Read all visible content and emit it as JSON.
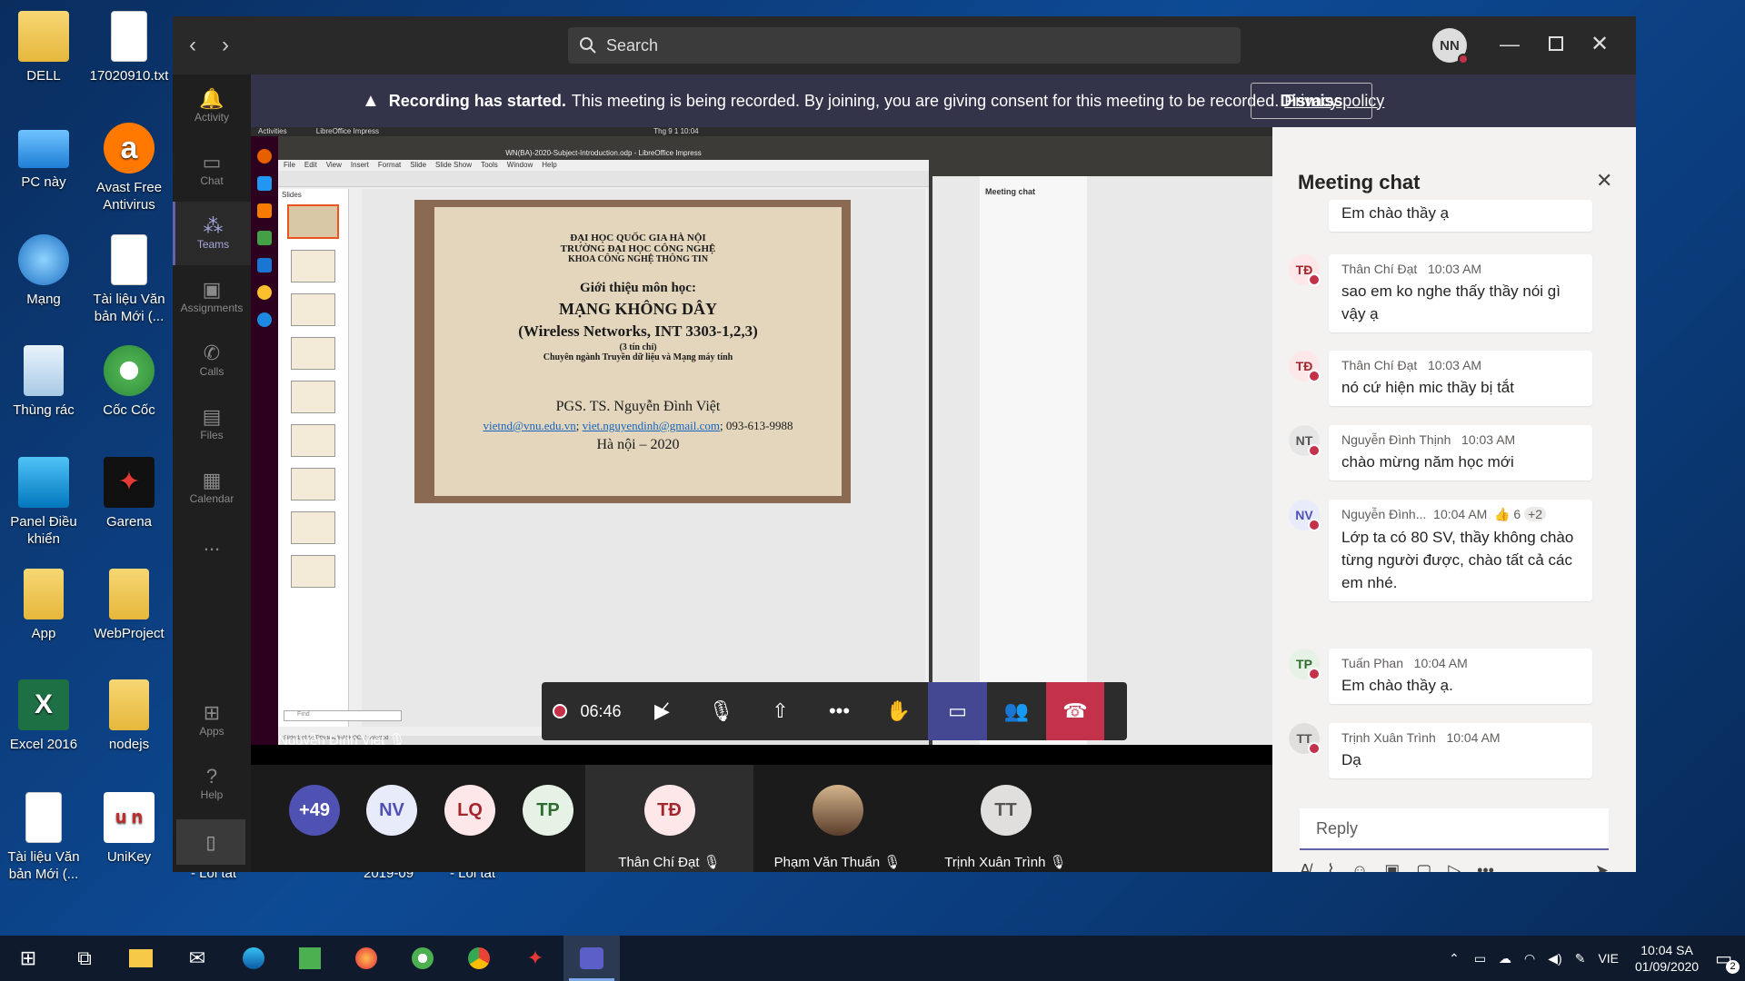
{
  "desktop": {
    "icons": [
      {
        "label": "DELL"
      },
      {
        "label": "17020910.txt"
      },
      {
        "label": "PC này"
      },
      {
        "label": "Avast Free Antivirus"
      },
      {
        "label": "Mạng"
      },
      {
        "label": "Tài liệu Văn bản Mới (..."
      },
      {
        "label": "Thùng rác"
      },
      {
        "label": "Cốc Cốc"
      },
      {
        "label": "Panel Điều khiển"
      },
      {
        "label": "Garena"
      },
      {
        "label": "App"
      },
      {
        "label": "WebProject"
      },
      {
        "label": "Excel 2016"
      },
      {
        "label": "nodejs"
      },
      {
        "label": "Tài liệu Văn bản Mới (..."
      },
      {
        "label": "UniKey"
      }
    ],
    "behind_labels": [
      "- Lối tắt",
      "2019-09",
      "- Lối tắt"
    ]
  },
  "teams": {
    "search_placeholder": "Search",
    "user_initials": "NN",
    "rail": [
      {
        "label": "Activity",
        "icon": "bell-icon"
      },
      {
        "label": "Chat",
        "icon": "chat-icon"
      },
      {
        "label": "Teams",
        "icon": "teams-icon"
      },
      {
        "label": "Assignments",
        "icon": "bag-icon"
      },
      {
        "label": "Calls",
        "icon": "phone-icon"
      },
      {
        "label": "Files",
        "icon": "file-icon"
      },
      {
        "label": "Calendar",
        "icon": "calendar-icon"
      },
      {
        "label": "...",
        "icon": "more-icon"
      }
    ],
    "rail_bottom": [
      {
        "label": "Apps"
      },
      {
        "label": "Help"
      }
    ],
    "banner": {
      "bold": "Recording has started.",
      "text": "This meeting is being recorded. By joining, you are giving consent for this meeting to be recorded.",
      "link": "Privacy policy",
      "dismiss": "Dismiss"
    },
    "share": {
      "topbar_activities": "Activities",
      "topbar_app": "LibreOffice Impress",
      "topbar_clock": "Thg 9 1  10:04",
      "window_title": "WN(BA)-2020-Subject-Introduction.odp - LibreOffice Impress",
      "menu": [
        "File",
        "Edit",
        "View",
        "Insert",
        "Format",
        "Slide",
        "Slide Show",
        "Tools",
        "Window",
        "Help"
      ],
      "slides_label": "Slides",
      "find_placeholder": "Find",
      "statusbar": "Slide 1 of 14     Title text 'ĐẠI HỌC...' selected",
      "presenter_name": "Nguyễn Đình Việt",
      "slide": {
        "l1": "ĐẠI HỌC QUỐC GIA HÀ NỘI",
        "l2": "TRƯỜNG ĐẠI HỌC CÔNG NGHỆ",
        "l3": "KHOA CÔNG NGHỆ THÔNG TIN",
        "l4": "Giới thiệu môn học:",
        "l5": "MẠNG KHÔNG DÂY",
        "l6": "(Wireless Networks, INT 3303-1,2,3)",
        "l7": "(3 tín chỉ)",
        "l8": "Chuyên ngành Truyền dữ liệu và Mạng máy tính",
        "l9": "PGS. TS. Nguyễn Đình Việt",
        "email1": "vietnd@vnu.edu.vn",
        "email2": "viet.nguyendinh@gmail.com",
        "phone": "; 093-613-9988",
        "l11": "Hà nội – 2020"
      },
      "mini_chat_title": "Meeting chat"
    },
    "timer": "06:46",
    "gallery": [
      {
        "initials": "+49",
        "name": ""
      },
      {
        "initials": "NV",
        "name": ""
      },
      {
        "initials": "LQ",
        "name": ""
      },
      {
        "initials": "TP",
        "name": ""
      },
      {
        "initials": "TĐ",
        "name": "Thân Chí Đạt"
      },
      {
        "initials": "",
        "name": "Phạm Văn Thuấn"
      },
      {
        "initials": "TT",
        "name": "Trịnh Xuân Trình"
      }
    ]
  },
  "chat": {
    "title": "Meeting chat",
    "messages": [
      {
        "initials": "TT",
        "sender": "",
        "time": "",
        "text": "Em chào thầy ạ"
      },
      {
        "initials": "TĐ",
        "sender": "Thân Chí Đạt",
        "time": "10:03 AM",
        "text": "sao em ko nghe thấy thầy nói gì vậy ạ"
      },
      {
        "initials": "TĐ",
        "sender": "Thân Chí Đạt",
        "time": "10:03 AM",
        "text": "nó cứ hiện mic thầy bị tắt"
      },
      {
        "initials": "NT",
        "sender": "Nguyễn Đình Thịnh",
        "time": "10:03 AM",
        "text": "chào mừng năm học mới"
      },
      {
        "initials": "NV",
        "sender": "Nguyễn Đình...",
        "time": "10:04 AM",
        "reactions": "👍 6",
        "more": "+2",
        "text": "Lớp ta có 80 SV, thầy không chào từng người được, chào tất cả các em nhé."
      },
      {
        "initials": "TP",
        "sender": "Tuấn Phan",
        "time": "10:04 AM",
        "text": "Em chào thầy ạ."
      },
      {
        "initials": "TT",
        "sender": "Trịnh Xuân Trình",
        "time": "10:04 AM",
        "text": "Dạ"
      }
    ],
    "reply_placeholder": "Reply"
  },
  "taskbar": {
    "language": "VIE",
    "time": "10:04 SA",
    "date": "01/09/2020",
    "notifications": "2"
  }
}
